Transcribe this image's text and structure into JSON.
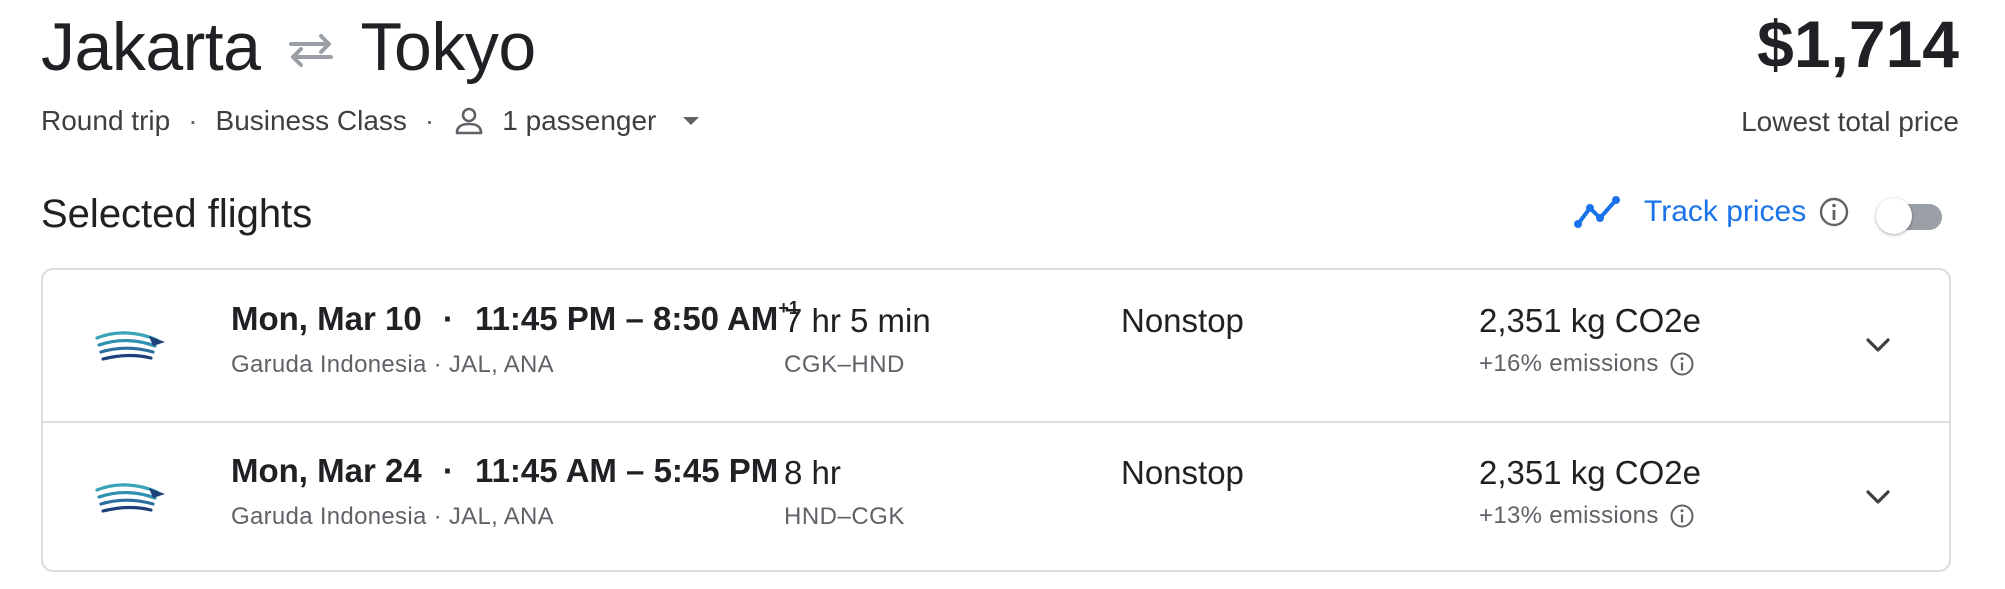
{
  "header": {
    "origin": "Jakarta",
    "destination": "Tokyo",
    "trip_type": "Round trip",
    "separator": "·",
    "cabin_class": "Business Class",
    "passengers": "1 passenger",
    "price": "$1,714",
    "price_label": "Lowest total price"
  },
  "section": {
    "title": "Selected flights",
    "track_label": "Track prices",
    "track_enabled": false
  },
  "flights": [
    {
      "date": "Mon, Mar 10",
      "times": "11:45 PM – 8:50 AM",
      "day_offset": "+1",
      "airline": "Garuda Indonesia · JAL, ANA",
      "duration": "7 hr 5 min",
      "airports": "CGK–HND",
      "stops": "Nonstop",
      "co2": "2,351 kg CO2e",
      "emissions": "+16% emissions"
    },
    {
      "date": "Mon, Mar 24",
      "times": "11:45 AM – 5:45 PM",
      "day_offset": "",
      "airline": "Garuda Indonesia · JAL, ANA",
      "duration": "8 hr",
      "airports": "HND–CGK",
      "stops": "Nonstop",
      "co2": "2,351 kg CO2e",
      "emissions": "+13% emissions"
    }
  ],
  "icons": {
    "swap": "swap-arrows-icon",
    "passenger": "person-icon",
    "dropdown": "caret-down-icon",
    "track": "trending-line-icon",
    "info": "info-icon",
    "expand": "chevron-down-icon",
    "airline_logo": "garuda-logo"
  },
  "colors": {
    "accent": "#1a73e8",
    "text": "#202124",
    "secondary_text": "#5f6368",
    "border": "#dadce0",
    "logo_teal": "#3aa3b8",
    "logo_navy": "#1d3f7a"
  }
}
